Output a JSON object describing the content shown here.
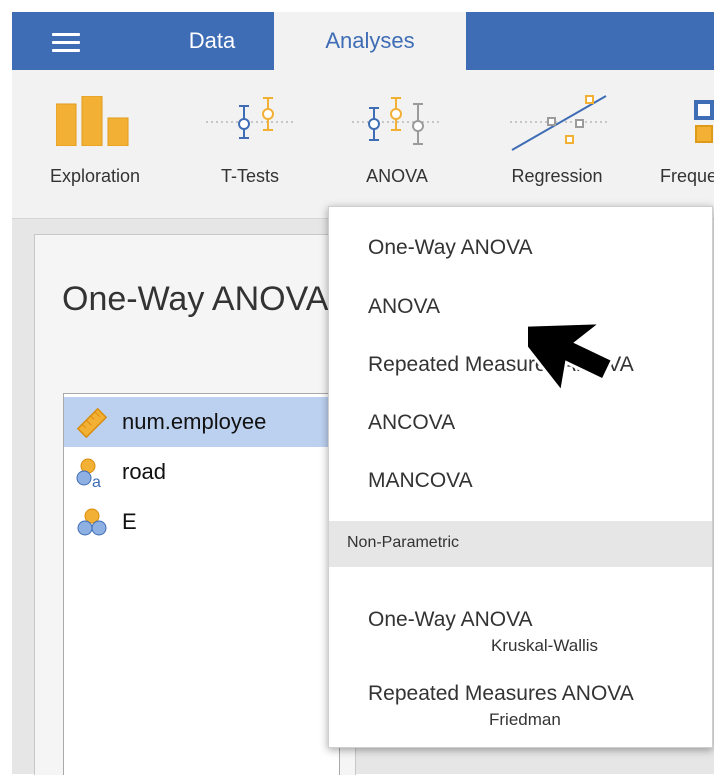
{
  "topbar": {
    "background": "#3e6db5",
    "menu_icon": "hamburger-icon",
    "tabs": [
      {
        "label": "Data",
        "active": false
      },
      {
        "label": "Analyses",
        "active": true
      }
    ]
  },
  "ribbon": {
    "accent_colors": {
      "orange": "#f2b134",
      "blue": "#3e6db5",
      "gray": "#9b9b9b"
    },
    "buttons": [
      {
        "label": "Exploration",
        "icon": "bar-chart-icon"
      },
      {
        "label": "T-Tests",
        "icon": "t-test-icon"
      },
      {
        "label": "ANOVA",
        "icon": "anova-icon"
      },
      {
        "label": "Regression",
        "icon": "regression-icon"
      },
      {
        "label": "Freque",
        "icon": "frequencies-icon"
      }
    ]
  },
  "analysis_panel": {
    "title": "One-Way ANOVA",
    "variables": [
      {
        "name": "num.employee",
        "icon": "ruler-icon",
        "selected": true
      },
      {
        "name": "road",
        "icon": "nominal-text-icon",
        "selected": false
      },
      {
        "name": "E",
        "icon": "nominal-icon",
        "selected": false
      }
    ]
  },
  "anova_menu": {
    "items": [
      {
        "label": "One-Way ANOVA"
      },
      {
        "label": "ANOVA"
      },
      {
        "label": "Repeated Measures ANOVA"
      },
      {
        "label": "ANCOVA"
      },
      {
        "label": "MANCOVA"
      }
    ],
    "section_header": "Non-Parametric",
    "nonparametric_items": [
      {
        "label": "One-Way ANOVA",
        "sublabel": "Kruskal-Wallis"
      },
      {
        "label": "Repeated Measures ANOVA",
        "sublabel": "Friedman"
      }
    ]
  },
  "cursor": {
    "icon": "mouse-pointer-icon"
  }
}
